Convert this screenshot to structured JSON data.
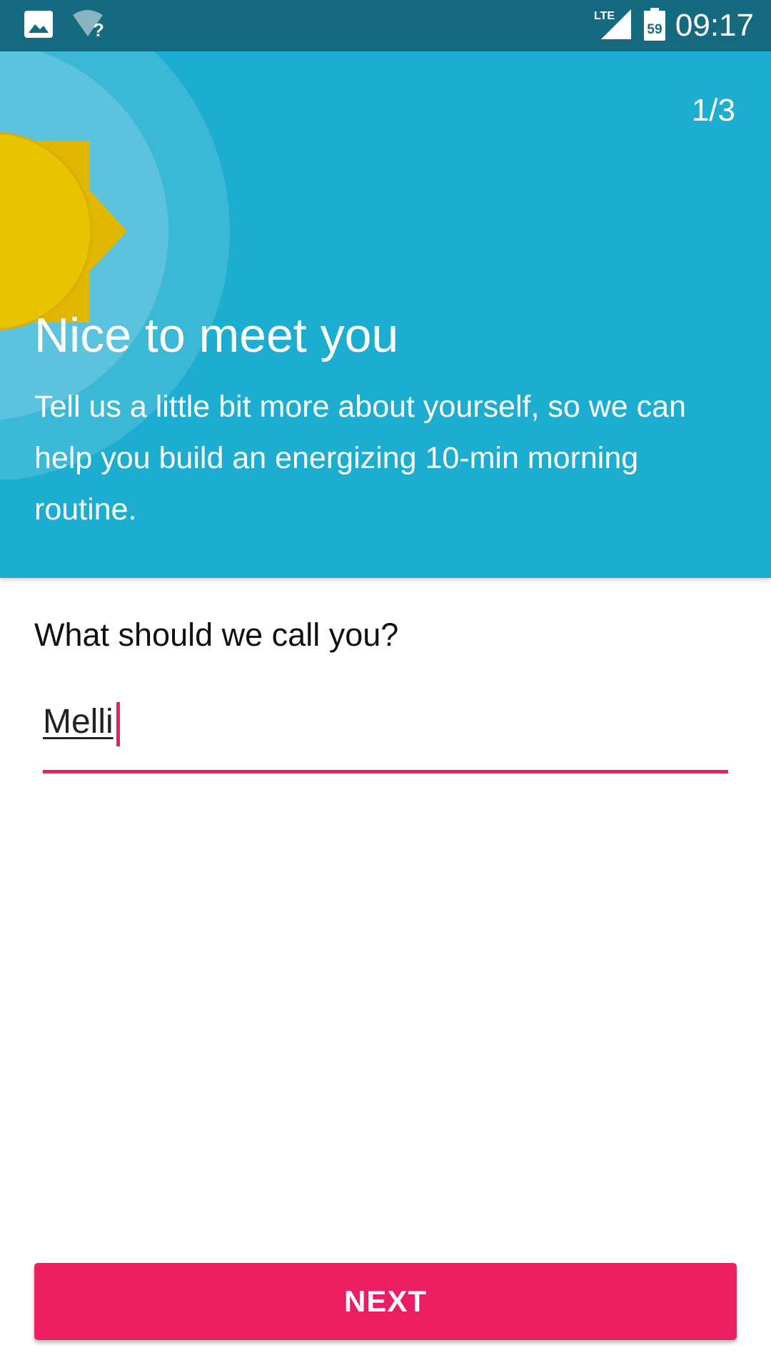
{
  "status_bar": {
    "time": "09:17",
    "network_label": "LTE",
    "battery_level": "59",
    "wifi_state": "?",
    "icons": [
      "image-notification-icon",
      "wifi-unknown-icon",
      "lte-signal-icon",
      "battery-icon"
    ]
  },
  "onboarding": {
    "step_indicator": "1/3",
    "title": "Nice to meet you",
    "description": "Tell us a little bit more about yourself, so we can help you build an energizing 10-min morning routine.",
    "question": "What should we call you?",
    "name_input_value": "Melli",
    "next_button_label": "NEXT"
  },
  "colors": {
    "status_bar": "#156a80",
    "header_background": "#1dadd1",
    "accent": "#ec1e62",
    "sun": "#e8c300",
    "sun_rays": "#e0b600"
  }
}
